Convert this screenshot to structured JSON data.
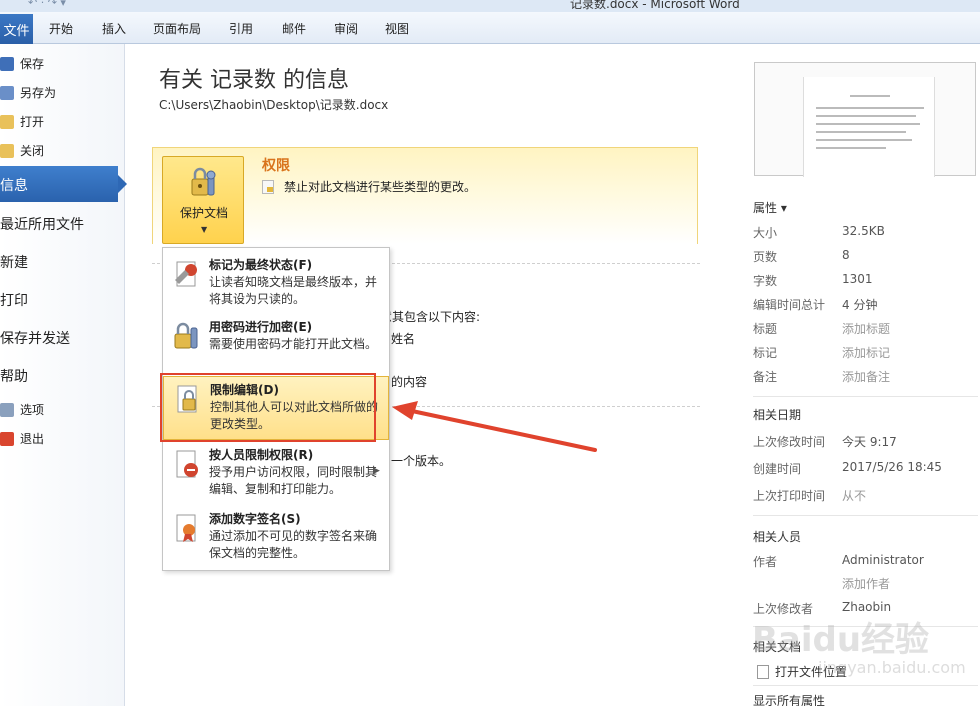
{
  "window": {
    "title": "记录数.docx - Microsoft Word"
  },
  "ribbon": {
    "file_tab": "文件",
    "tabs": [
      "开始",
      "插入",
      "页面布局",
      "引用",
      "邮件",
      "审阅",
      "视图"
    ]
  },
  "leftnav": {
    "small_items": [
      "保存",
      "另存为",
      "打开",
      "关闭"
    ],
    "active": "信息",
    "big_items": [
      "最近所用文件",
      "新建",
      "打印",
      "保存并发送",
      "帮助"
    ],
    "bottom_items": [
      "选项",
      "退出"
    ]
  },
  "main": {
    "title": "有关 记录数 的信息",
    "path": "C:\\Users\\Zhaobin\\Desktop\\记录数.docx",
    "permissions": {
      "button_label": "保护文档",
      "heading": "权限",
      "description": "禁止对此文档进行某些类型的更改。"
    },
    "partial_texts": {
      "t1": "意其包含以下内容:",
      "t2": "姓名",
      "t3": "的内容",
      "t4": "一个版本。"
    },
    "dropdown": [
      {
        "title": "标记为最终状态(F)",
        "desc": "让读者知晓文档是最终版本，并将其设为只读的。"
      },
      {
        "title": "用密码进行加密(E)",
        "desc": "需要使用密码才能打开此文档。"
      },
      {
        "title": "限制编辑(D)",
        "desc": "控制其他人可以对此文档所做的更改类型。"
      },
      {
        "title": "按人员限制权限(R)",
        "desc": "授予用户访问权限，同时限制其编辑、复制和打印能力。"
      },
      {
        "title": "添加数字签名(S)",
        "desc": "通过添加不可见的数字签名来确保文档的完整性。"
      }
    ]
  },
  "right_panel": {
    "properties_heading": "属性 ▾",
    "properties": [
      {
        "label": "大小",
        "value": "32.5KB"
      },
      {
        "label": "页数",
        "value": "8"
      },
      {
        "label": "字数",
        "value": "1301"
      },
      {
        "label": "编辑时间总计",
        "value": "4 分钟"
      },
      {
        "label": "标题",
        "value": "添加标题"
      },
      {
        "label": "标记",
        "value": "添加标记"
      },
      {
        "label": "备注",
        "value": "添加备注"
      }
    ],
    "dates_heading": "相关日期",
    "dates": [
      {
        "label": "上次修改时间",
        "value": "今天 9:17"
      },
      {
        "label": "创建时间",
        "value": "2017/5/26 18:45"
      },
      {
        "label": "上次打印时间",
        "value": "从不"
      }
    ],
    "people_heading": "相关人员",
    "author_label": "作者",
    "author_value": "Administrator",
    "add_author": "添加作者",
    "last_modified_by_label": "上次修改者",
    "last_modified_by_value": "Zhaobin",
    "related_docs": "相关文档",
    "open_location": "打开文件位置",
    "show_all": "显示所有属性"
  },
  "watermark": {
    "main": "Baidu经验",
    "sub": "jingyan.baidu.com"
  },
  "colors": {
    "accent": "#2a62ad",
    "highlight": "#ffe08a",
    "annotation": "#e0432d"
  }
}
